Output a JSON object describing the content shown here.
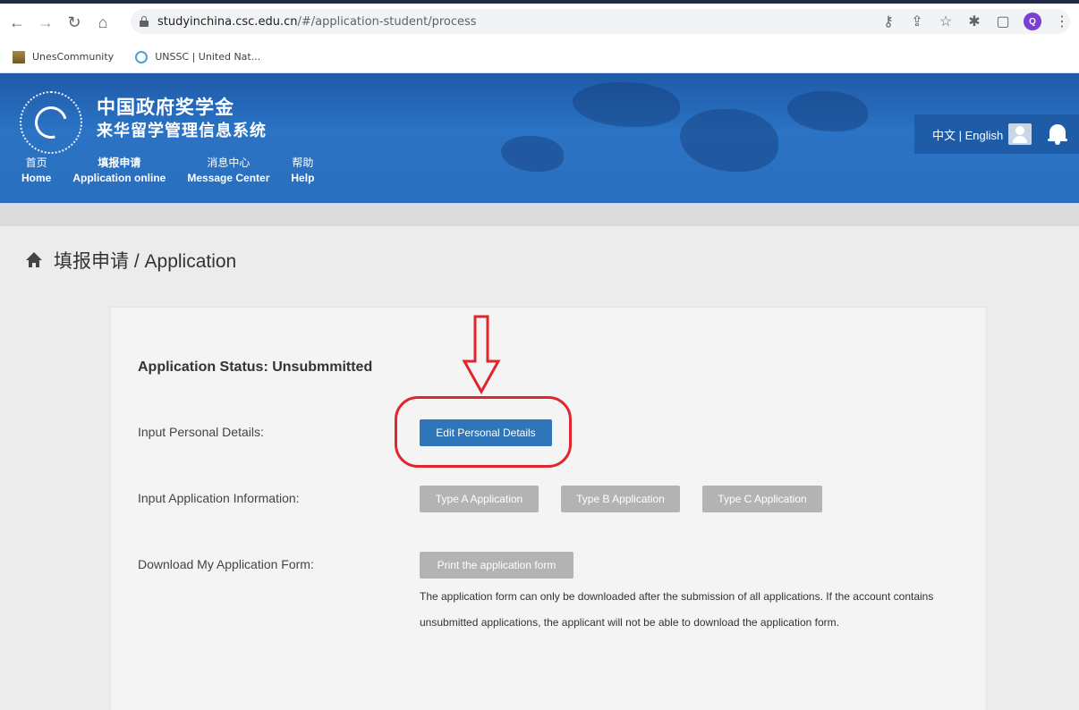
{
  "browser": {
    "url_host": "studyinchina.csc.edu.cn",
    "url_path": "/#/application-student/process",
    "profile_initial": "Q",
    "bookmarks": [
      "UnesCommunity",
      "UNSSC | United Nat..."
    ],
    "icons": [
      "back-icon",
      "forward-icon",
      "reload-icon",
      "home-icon",
      "lock-icon",
      "key-icon",
      "share-icon",
      "star-icon",
      "extensions-icon",
      "sidepanel-icon",
      "menu-icon"
    ]
  },
  "site": {
    "title_line1": "中国政府奖学金",
    "title_line2": "来华留学管理信息系统",
    "lang_switch": "中文 | English",
    "nav": [
      {
        "cn": "首页",
        "en": "Home"
      },
      {
        "cn": "填报申请",
        "en": "Application online"
      },
      {
        "cn": "消息中心",
        "en": "Message Center"
      },
      {
        "cn": "帮助",
        "en": "Help"
      }
    ]
  },
  "page": {
    "heading": "填报申请 / Application",
    "status": "Application Status: Unsubmmitted",
    "personal_label": "Input Personal Details:",
    "personal_button": "Edit Personal Details",
    "application_label": "Input Application Information:",
    "type_a": "Type A Application",
    "type_b": "Type B Application",
    "type_c": "Type C Application",
    "download_label": "Download My Application Form:",
    "print_button": "Print the application form",
    "note": "The application form can only be downloaded after the submission of all applications. If the account contains unsubmitted applications, the applicant will not be able to download the application form."
  },
  "colors": {
    "header_blue": "#2b73c4",
    "primary_button": "#2f75b8",
    "disabled_button": "#b3b3b3",
    "annotation_red": "#e0252b"
  }
}
